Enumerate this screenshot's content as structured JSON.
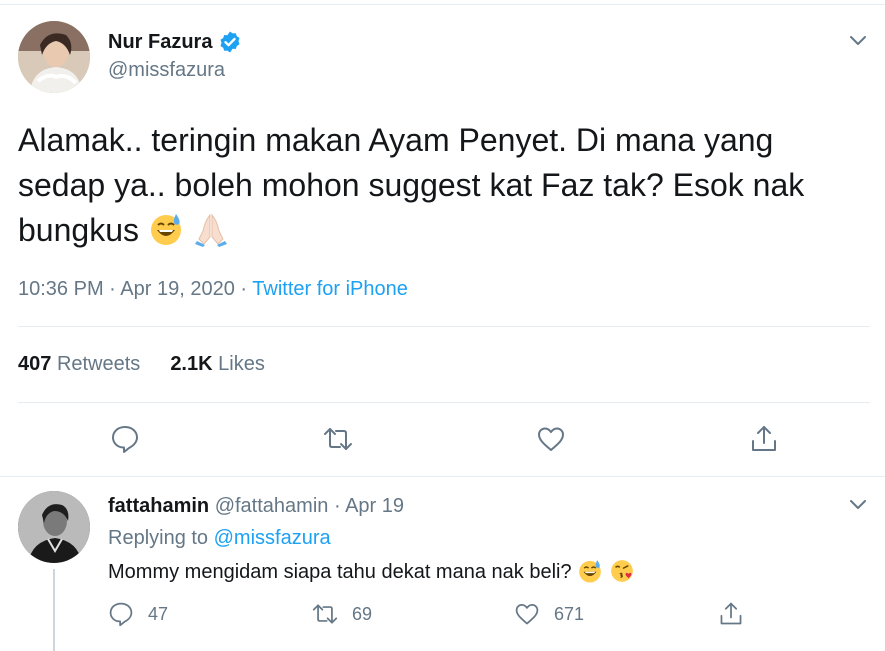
{
  "tweet": {
    "author_name": "Nur Fazura",
    "author_handle": "@missfazura",
    "text_line1": "Alamak.. teringin makan Ayam Penyet. Di mana yang",
    "text_line2": "sedap ya.. boleh mohon suggest kat Faz tak? Esok nak",
    "text_line3": "bungkus",
    "emojis": [
      "grinning-sweat-emoji",
      "folded-hands-emoji"
    ],
    "time": "10:36 PM",
    "date": "Apr 19, 2020",
    "separator": "·",
    "source": "Twitter for iPhone",
    "retweets_count": "407",
    "retweets_label": "Retweets",
    "likes_count": "2.1K",
    "likes_label": "Likes",
    "actions": [
      "reply-icon",
      "retweet-icon",
      "like-icon",
      "share-icon"
    ]
  },
  "reply": {
    "author_name": "fattahamin",
    "author_handle": "@fattahamin",
    "separator": "·",
    "date": "Apr 19",
    "replying_prefix": "Replying to",
    "replying_to": "@missfazura",
    "text": "Mommy mengidam siapa tahu dekat mana nak beli?",
    "emojis": [
      "grinning-sweat-emoji",
      "kissing-heart-emoji"
    ],
    "reply_count": "47",
    "retweet_count": "69",
    "like_count": "671"
  },
  "colors": {
    "accent": "#1da1f2",
    "secondary_text": "#657786",
    "primary_text": "#14171a",
    "divider": "#e6ecf0"
  }
}
